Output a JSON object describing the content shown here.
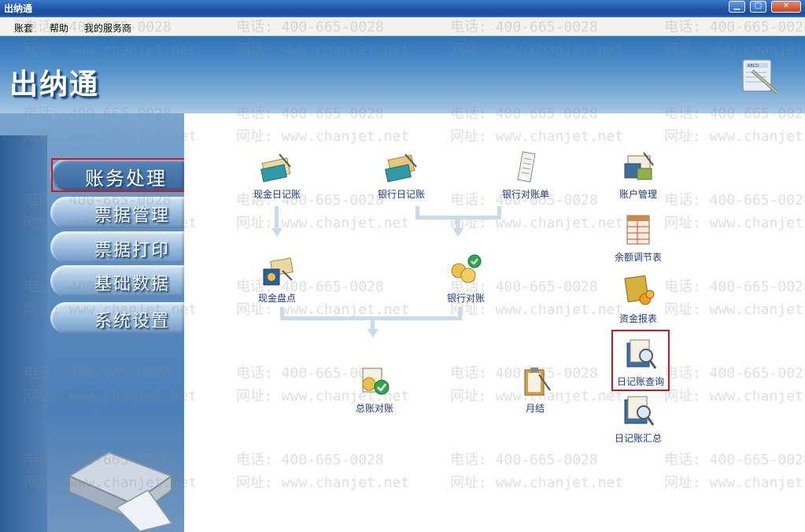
{
  "window": {
    "title": "出纳通",
    "minimize_icon": "minimize-icon",
    "maximize_icon": "maximize-icon",
    "close_icon": "close-icon"
  },
  "menu": {
    "items": [
      "账套",
      "帮助",
      "我的服务商"
    ]
  },
  "header": {
    "app_title": "出纳通",
    "logo_icon": "abcd-notebook-pen-icon"
  },
  "sidebar": {
    "items": [
      {
        "label": "账务处理",
        "active": true
      },
      {
        "label": "票据管理",
        "active": false
      },
      {
        "label": "票据打印",
        "active": false
      },
      {
        "label": "基础数据",
        "active": false
      },
      {
        "label": "系统设置",
        "active": false
      }
    ]
  },
  "modules": {
    "cash_journal": "现金日记账",
    "bank_journal": "银行日记账",
    "bank_statement": "银行对账单",
    "account_mgmt": "账户管理",
    "balance_adjust": "余额调节表",
    "cash_count": "现金盘点",
    "bank_reconcile": "银行对账",
    "fund_report": "资金报表",
    "journal_query": "日记账查询",
    "gl_reconcile": "总账对账",
    "month_end": "月结",
    "journal_summary": "日记账汇总"
  },
  "watermark": {
    "phone": "电话: 400-665-0028",
    "website": "网址: www.chanjet.net"
  },
  "colors": {
    "highlight": "#d8121f",
    "link_text": "#1a3c8c",
    "flow": "#c9dcec"
  }
}
